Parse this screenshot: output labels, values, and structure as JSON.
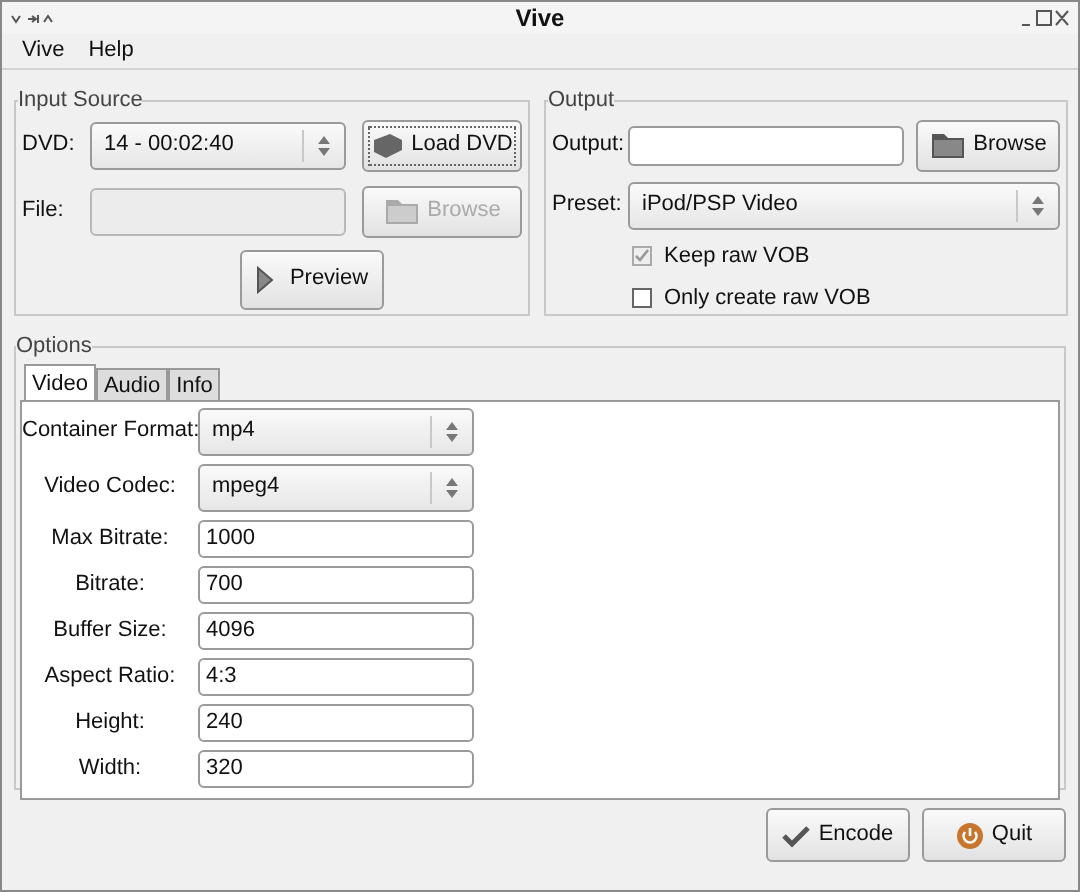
{
  "window": {
    "title": "Vive"
  },
  "menu": [
    {
      "label": "Vive"
    },
    {
      "label": "Help"
    }
  ],
  "input_source": {
    "title": "Input Source",
    "dvd": {
      "label": "DVD:",
      "value": "14 - 00:02:40"
    },
    "load_button": "Load DVD",
    "file": {
      "label": "File:",
      "disabled": true
    },
    "browse_button": {
      "label": "Browse",
      "disabled": true
    },
    "preview_button": "Preview"
  },
  "output": {
    "title": "Output",
    "output": {
      "label": "Output:"
    },
    "browse_button": {
      "label": "Browse"
    },
    "preset": {
      "label": "Preset:",
      "value": "iPod/PSP Video"
    },
    "checkboxes": [
      {
        "label": "Keep raw VOB",
        "checked": true,
        "disabled": true
      },
      {
        "label": "Only create raw VOB",
        "checked": false,
        "disabled": false
      }
    ]
  },
  "options": {
    "title": "Options",
    "tabs": [
      {
        "label": "Video",
        "selected": true
      },
      {
        "label": "Audio",
        "selected": false
      },
      {
        "label": "Info",
        "selected": false
      }
    ],
    "fields": [
      {
        "kind": "select",
        "label": "Container Format:",
        "value": "mp4"
      },
      {
        "kind": "select",
        "label": "Video Codec:",
        "value": "mpeg4"
      },
      {
        "kind": "text",
        "label": "Max Bitrate:",
        "value": "1000"
      },
      {
        "kind": "text",
        "label": "Bitrate:",
        "value": "700"
      },
      {
        "kind": "text",
        "label": "Buffer Size:",
        "value": "4096"
      },
      {
        "kind": "text",
        "label": "Aspect Ratio:",
        "value": "4:3"
      },
      {
        "kind": "text",
        "label": "Height:",
        "value": "240"
      },
      {
        "kind": "text",
        "label": "Width:",
        "value": "320"
      }
    ]
  },
  "buttons": [
    {
      "kind": "encode",
      "label": "Encode"
    },
    {
      "kind": "quit",
      "label": "Quit"
    }
  ]
}
